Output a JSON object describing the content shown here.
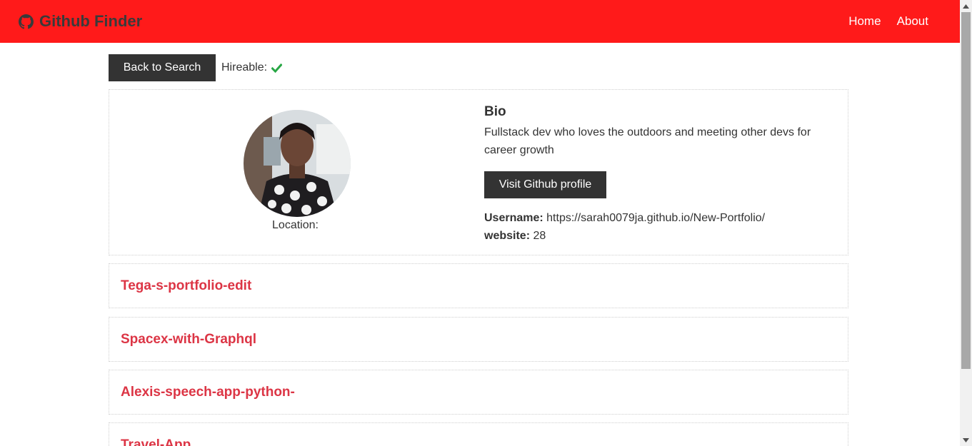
{
  "navbar": {
    "brand_icon": "github-icon",
    "title": "Github Finder",
    "links": [
      {
        "label": "Home"
      },
      {
        "label": "About"
      }
    ],
    "background_color": "#ff1a1a"
  },
  "top_bar": {
    "back_label": "Back to Search",
    "hireable_label": "Hireable:",
    "hireable_icon": "check-icon",
    "hireable_color": "#28a745"
  },
  "profile": {
    "location_label": "Location:",
    "location_value": "",
    "bio_heading": "Bio",
    "bio_text": "Fullstack dev who loves the outdoors and meeting other devs for career growth",
    "visit_label": "Visit Github profile",
    "username_label": "Username:",
    "username_value": "https://sarah0079ja.github.io/New-Portfolio/",
    "website_label": "website:",
    "website_value": "28"
  },
  "repos": [
    {
      "name": "Tega-s-portfolio-edit"
    },
    {
      "name": "Spacex-with-Graphql"
    },
    {
      "name": "Alexis-speech-app-python-"
    },
    {
      "name": "Travel-App"
    }
  ],
  "colors": {
    "repo_link": "#dc3545",
    "dark_button": "#333333"
  }
}
